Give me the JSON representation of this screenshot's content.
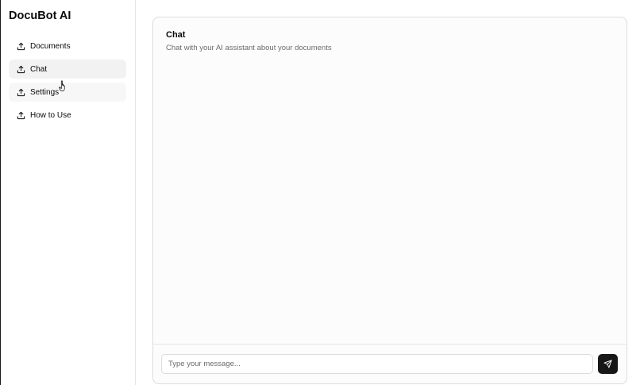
{
  "app": {
    "title": "DocuBot AI"
  },
  "sidebar": {
    "items": [
      {
        "label": "Documents",
        "icon": "upload-icon"
      },
      {
        "label": "Chat",
        "icon": "upload-icon",
        "active": true
      },
      {
        "label": "Settings",
        "icon": "upload-icon"
      },
      {
        "label": "How to Use",
        "icon": "upload-icon"
      }
    ]
  },
  "chat": {
    "title": "Chat",
    "subtitle": "Chat with your AI assistant about your documents",
    "input_placeholder": "Type your message...",
    "send_icon": "send-icon"
  },
  "colors": {
    "accent": "#171717",
    "active_nav_bg": "#f2f2f2",
    "border": "#e5e5e5"
  }
}
